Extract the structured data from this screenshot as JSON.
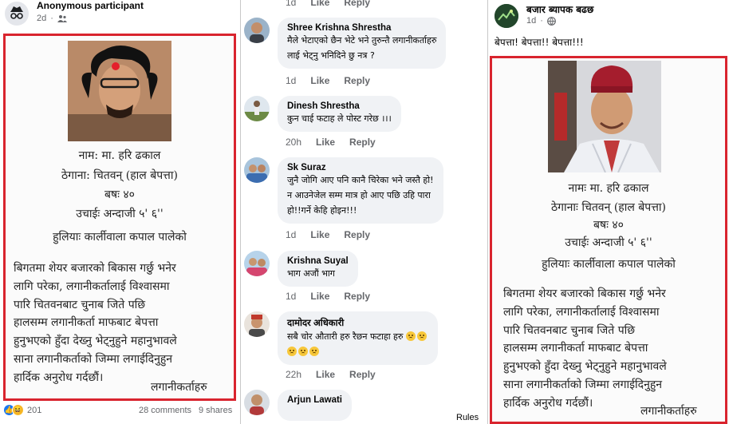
{
  "left_post": {
    "author": "Anonymous participant",
    "time": "2d",
    "notice": {
      "lines": [
        "नाम: मा. हरि ढकाल",
        "ठेगाना: चितवन् (हाल बेपत्ता)",
        "बषः ४०",
        "उचाईः अन्दाजी ५' ६''",
        "हुलियाः कार्लीवाला कपाल पालेको"
      ],
      "paragraph": [
        "बिगतमा शेयर बजारको बिकास गर्छु भनेर",
        "लागि परेका, लगानीकर्तालाई विश्वासमा",
        "पारि चितवनबाट चुनाब जिते पछि",
        "हालसम्म लगानीकर्ता माफबाट बेपत्ता",
        "हुनुभएको हुँदा देख्नु भेट्नुहुने महानुभावले",
        "साना लगानीकर्ताको जिम्मा लगाईदिनुहुन",
        "हार्दिक अनुरोध गर्दछौं।"
      ],
      "signature": "लगानीकर्ताहरु"
    },
    "footer": {
      "reaction_count": "201",
      "comments": "28 comments",
      "shares": "9 shares"
    }
  },
  "comments": [
    {
      "name": "Shree Krishna Shrestha",
      "lines": [
        "मैले भेटाएको छैन भेटे भने तुरुन्तै लगानीकर्ताहरु",
        "लाई भेट्नु भनिदिने छु नत्र ?"
      ],
      "time": "1d",
      "like": "Like",
      "reply": "Reply"
    },
    {
      "name": "Dinesh Shrestha",
      "lines": [
        "कुन चाई फटाह ले पोस्ट गरेछ ।।।"
      ],
      "time": "20h",
      "like": "Like",
      "reply": "Reply"
    },
    {
      "name": "Sk Suraz",
      "lines": [
        "जुनै जोगि आए पनि कानै चिरेका भने जस्तै हो!",
        "न आउनेजेल सम्म मात्र हो आए पछि उहि पारा",
        "हो!!गर्ने केहि होइन!!!"
      ],
      "time": "1d",
      "like": "Like",
      "reply": "Reply"
    },
    {
      "name": "Krishna Suyal",
      "lines": [
        "भाग अजौं भाग"
      ],
      "time": "1d",
      "like": "Like",
      "reply": "Reply"
    },
    {
      "name": "दामोदर अधिकारी",
      "lines": [
        "सबै चोर औतारी हरु रैछन फटाहा हरु"
      ],
      "time": "22h",
      "like": "Like",
      "reply": "Reply"
    },
    {
      "name": "Arjun Lawati",
      "lines": []
    }
  ],
  "top_partial": {
    "time": "1d",
    "like": "Like",
    "reply": "Reply"
  },
  "rules_label": "Rules",
  "right_post": {
    "author": "बजार ब्यापक बढछ",
    "time": "1d",
    "text": "बेपत्ता! बेपत्ता!! बेपत्ता!!!",
    "notice": {
      "lines": [
        "नामः मा. हरि ढकाल",
        "ठेगानाः चितवन् (हाल बेपत्ता)",
        "बषः ४०",
        "उचाईः अन्दाजी ५' ६''",
        "हुलियाः कार्लीवाला कपाल पालेको"
      ],
      "paragraph": [
        "बिगतमा शेयर बजारको बिकास गर्छु भनेर",
        "लागि परेका, लगानीकर्तालाई विश्वासमा",
        "पारि चितवनबाट चुनाब जिते पछि",
        "हालसम्म लगानीकर्ता माफबाट बेपत्ता",
        "हुनुभएको हुँदा देख्नु भेट्नुहुने महानुभावले",
        "साना लगानीकर्ताको जिम्मा लगाईदिनुहुन",
        "हार्दिक अनुरोध गर्दछौं।"
      ],
      "signature": "लगानीकर्ताहरु"
    }
  },
  "colors": {
    "notice_border": "#d9242e",
    "bubble": "#f0f2f5",
    "meta": "#65676b"
  }
}
